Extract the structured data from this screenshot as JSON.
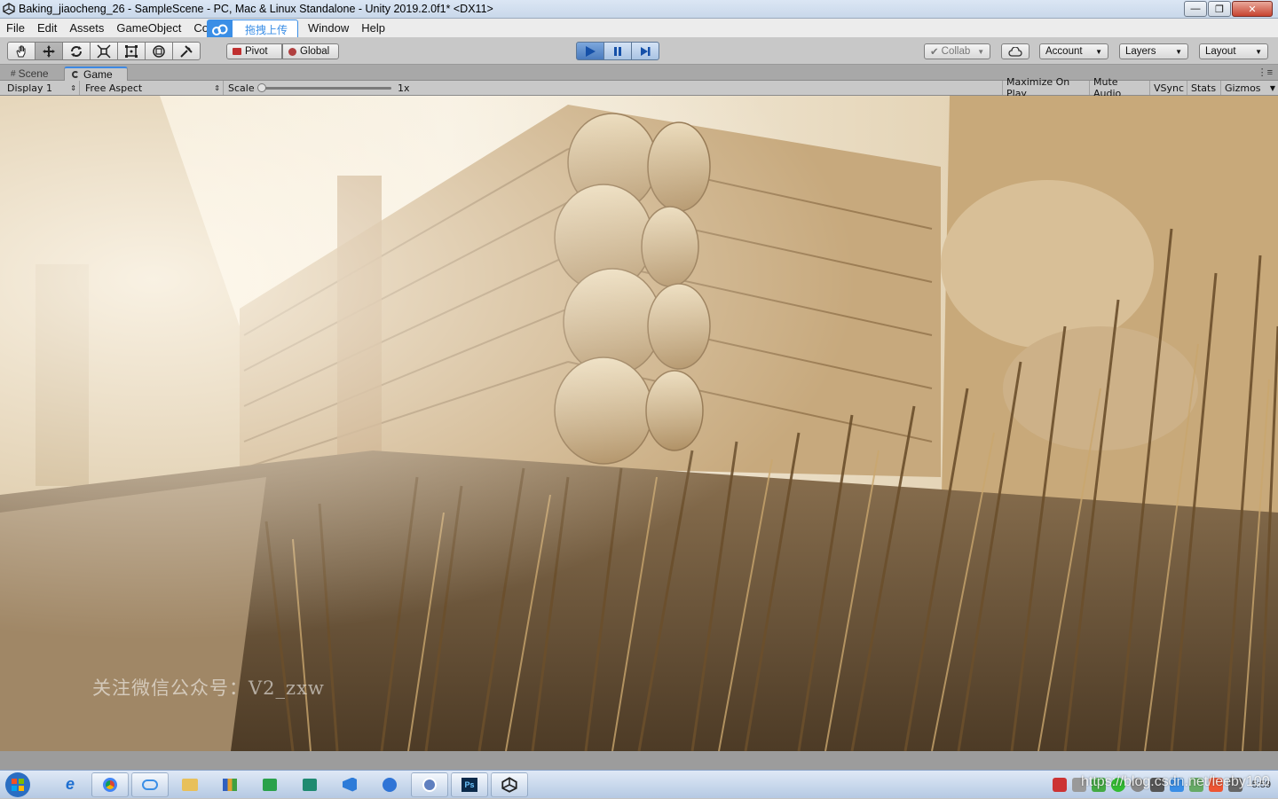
{
  "window": {
    "title": "Baking_jiaocheng_26 - SampleScene - PC, Mac & Linux Standalone - Unity 2019.2.0f1* <DX11>",
    "buttons": {
      "minimize": "—",
      "maximize": "❐",
      "close": "✕"
    }
  },
  "menu": [
    "File",
    "Edit",
    "Assets",
    "GameObject",
    "Co",
    "Window",
    "Help"
  ],
  "upload_badge": {
    "label": "拖拽上传"
  },
  "toolbar": {
    "transform_tools": [
      "hand-icon",
      "move-icon",
      "rotate-icon",
      "scale-icon",
      "rect-icon",
      "transform-icon",
      "custom-tool-icon"
    ],
    "pivot": "Pivot",
    "global": "Global",
    "collab": "Collab",
    "account": "Account",
    "layers": "Layers",
    "layout": "Layout",
    "play_state": "playing"
  },
  "tabs": {
    "scene": "Scene",
    "game": "Game",
    "menu": "⋮≡"
  },
  "gamebar": {
    "display": "Display 1",
    "aspect": "Free Aspect",
    "scale_label": "Scale",
    "scale_value": "1x",
    "maximize": "Maximize On Play",
    "mute": "Mute Audio",
    "vsync": "VSync",
    "stats": "Stats",
    "gizmos": "Gizmos"
  },
  "viewport": {
    "watermark": "关注微信公众号：V2_zxw"
  },
  "taskbar": {
    "items": [
      "ie-icon",
      "chrome-icon",
      "baidu-netdisk-icon",
      "folder-icon",
      "chart-app-icon",
      "terminal-icon",
      "vs-icon",
      "vscode-icon",
      "flow-icon",
      "video-app-icon",
      "photoshop-icon",
      "unity-icon"
    ],
    "csdn_watermark": "https://blog.csdn.net/leeby100",
    "clock": "5:59"
  },
  "colors": {
    "accent": "#3d89e4",
    "play": "#4a7bbe",
    "viewport_tone": "#bfa27a"
  }
}
